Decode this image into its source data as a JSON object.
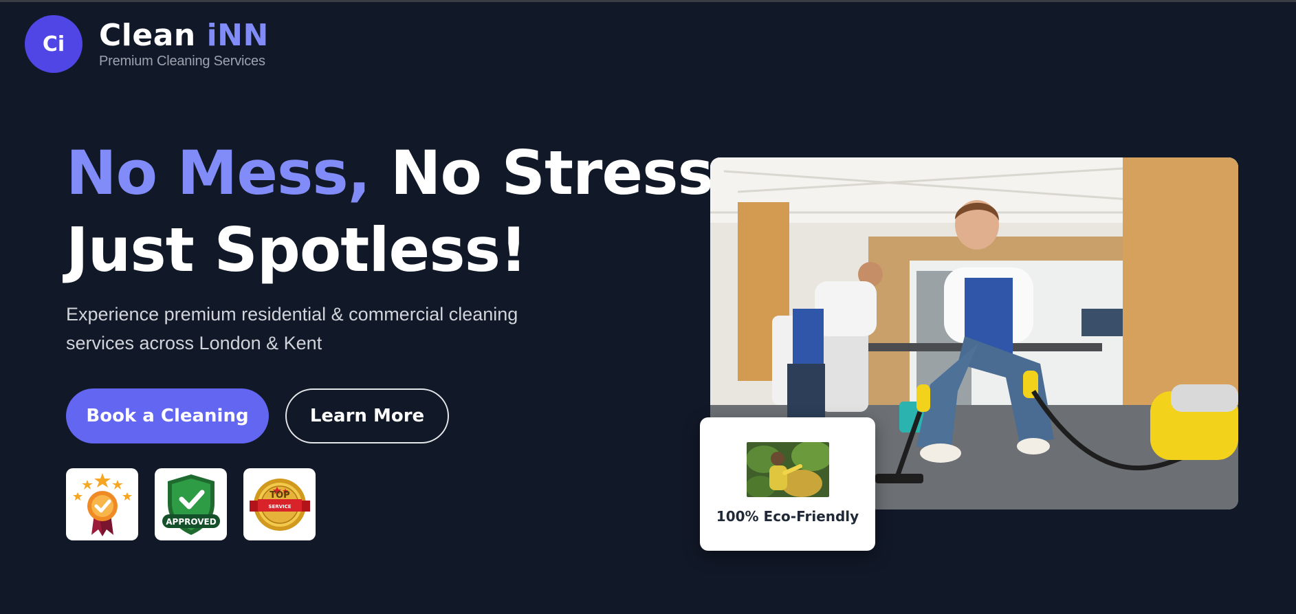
{
  "brand": {
    "logo_text": "Ci",
    "name_part1": "Clean ",
    "name_part2": "iNN",
    "tagline": "Premium Cleaning Services"
  },
  "hero": {
    "headline_accent": "No Mess,",
    "headline_rest": " No Stress.",
    "headline_line2": "Just Spotless!",
    "subtitle_line1": "Experience premium residential & commercial cleaning",
    "subtitle_line2": "services across London & Kent"
  },
  "buttons": {
    "primary_label": "Book a Cleaning",
    "secondary_label": "Learn More"
  },
  "badges": [
    {
      "icon": "award-stars-medal-icon"
    },
    {
      "icon": "approved-shield-icon",
      "text": "APPROVED"
    },
    {
      "icon": "top-service-seal-icon",
      "text_top": "TOP",
      "text_bottom": "SERVICE"
    }
  ],
  "eco_card": {
    "label": "100% Eco-Friendly"
  },
  "colors": {
    "background": "#111827",
    "accent": "#818cf8",
    "button_primary": "#6366f1",
    "logo": "#4f46e5"
  }
}
